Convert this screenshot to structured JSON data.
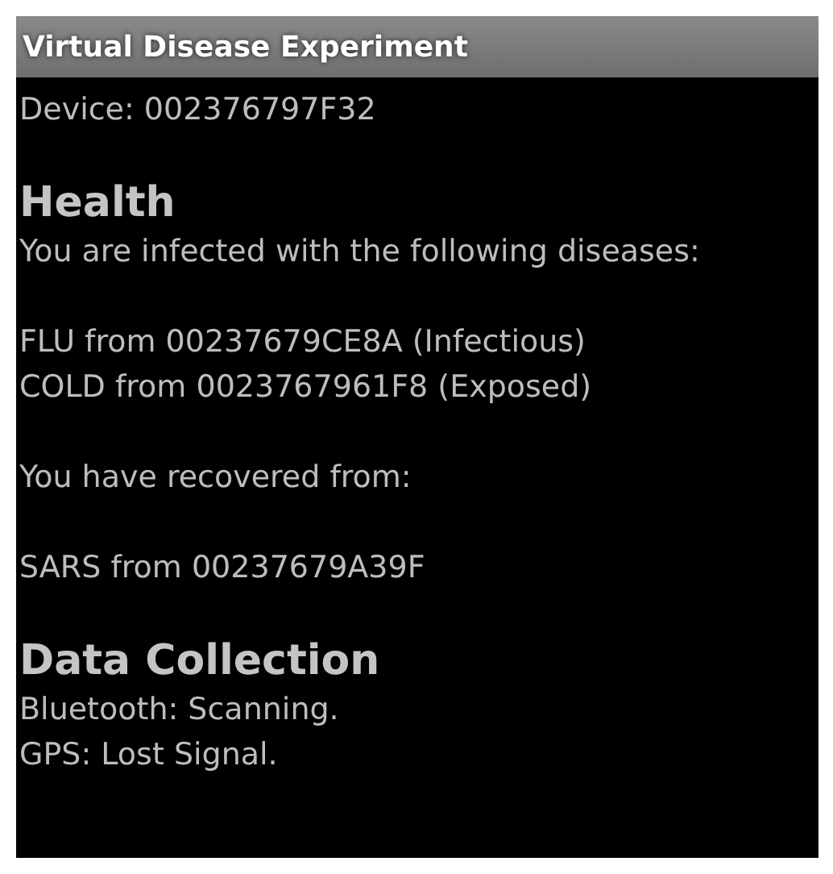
{
  "window": {
    "title": "Virtual Disease Experiment"
  },
  "device": "Device: 002376797F32",
  "sections": [
    {
      "heading": "Health",
      "paragraphs": [
        [
          "You are infected with the following diseases:"
        ],
        [
          "FLU from 00237679CE8A (Infectious)",
          "COLD from 0023767961F8 (Exposed)"
        ],
        [
          "You have recovered from:"
        ],
        [
          "SARS from 00237679A39F"
        ]
      ]
    },
    {
      "heading": "Data Collection",
      "paragraphs": [
        [
          "Bluetooth: Scanning.",
          "GPS: Lost Signal."
        ]
      ]
    }
  ]
}
